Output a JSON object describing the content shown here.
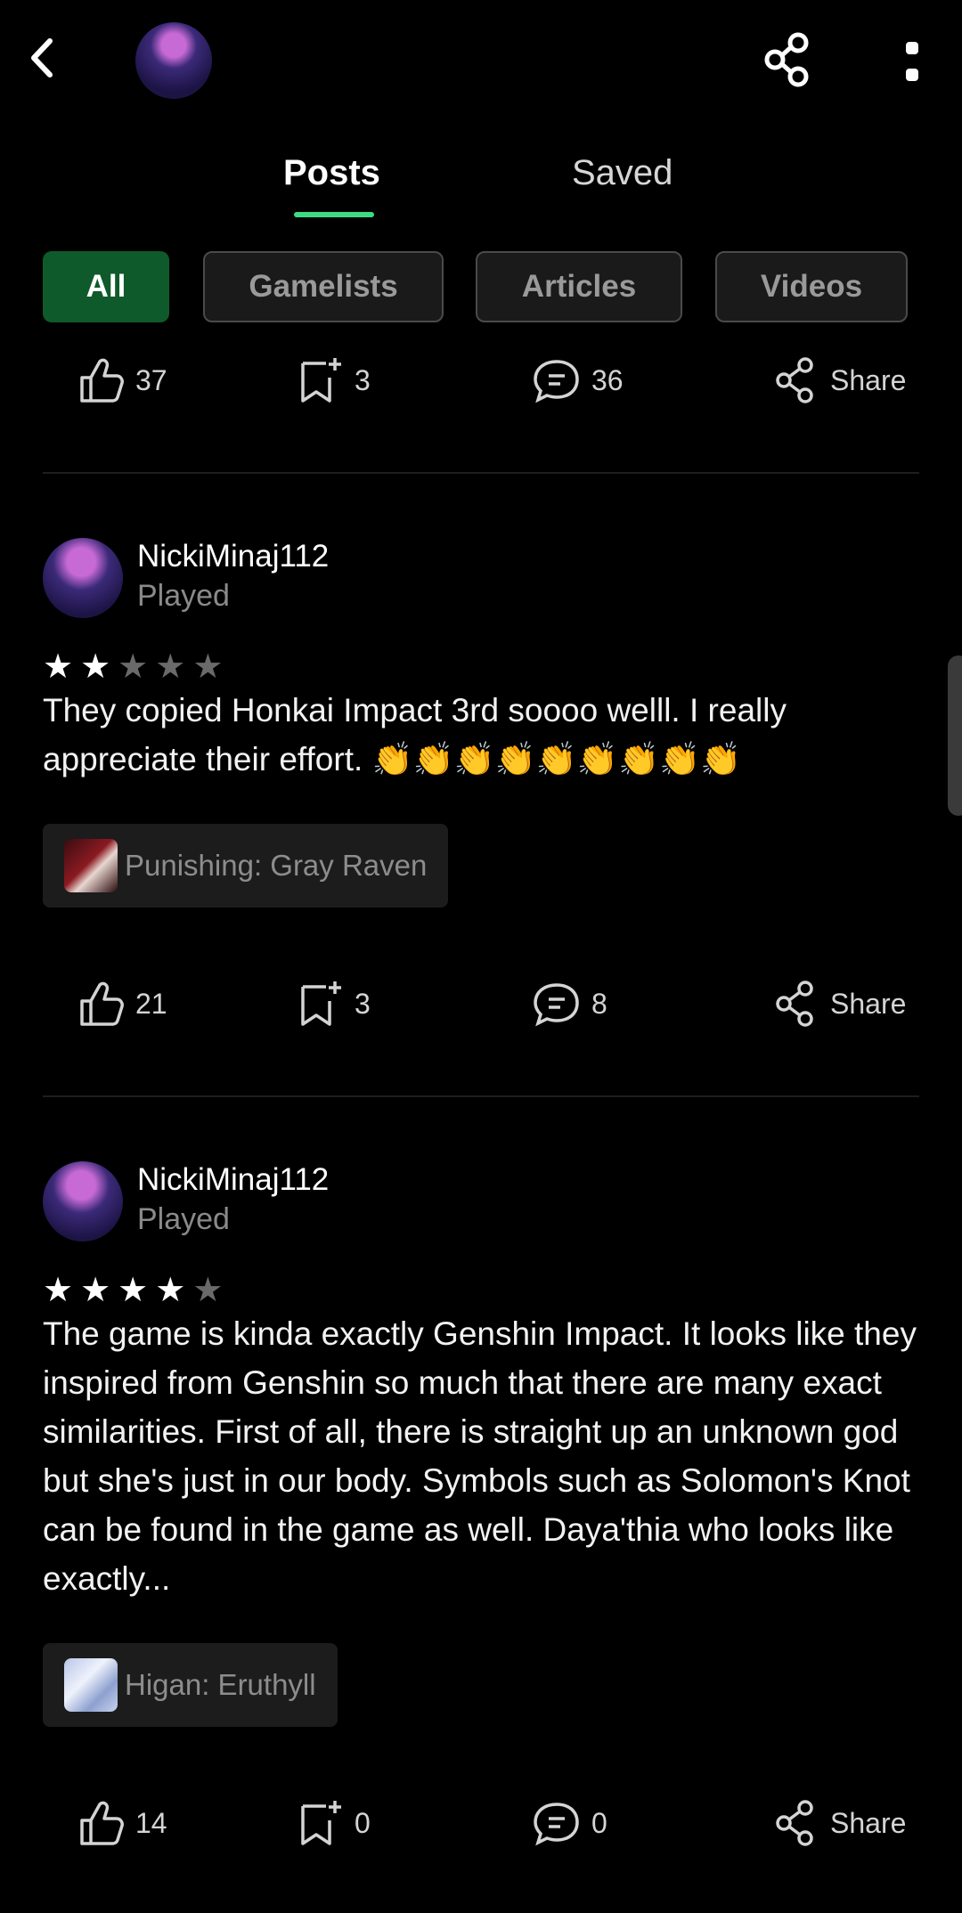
{
  "header": {
    "tabs": [
      {
        "label": "Posts"
      },
      {
        "label": "Saved"
      }
    ]
  },
  "filters": [
    "All",
    "Gamelists",
    "Articles",
    "Videos"
  ],
  "top_actions": {
    "likes": "37",
    "saves": "3",
    "comments": "36",
    "share": "Share"
  },
  "posts": [
    {
      "username": "NickiMinaj112",
      "status": "Played",
      "rating": 2,
      "text": "They copied Honkai Impact 3rd soooo welll. I really appreciate their effort. 👏👏👏👏👏👏👏👏👏",
      "game": "Punishing: Gray Raven",
      "actions": {
        "likes": "21",
        "saves": "3",
        "comments": "8",
        "share": "Share"
      }
    },
    {
      "username": "NickiMinaj112",
      "status": "Played",
      "rating": 4,
      "text": "The game is kinda exactly Genshin Impact. It looks like they inspired from Genshin so much that there are many exact similarities. First of all, there is straight up an unknown god but she's just in our body. Symbols such as Solomon's Knot can be found in the game as well. Daya'thia who looks like exactly...",
      "game": "Higan: Eruthyll",
      "actions": {
        "likes": "14",
        "saves": "0",
        "comments": "0",
        "share": "Share"
      }
    }
  ],
  "colors": {
    "accent": "#3ddc84",
    "chip_active_bg": "#0f5a2a",
    "star_filled": "#ffffff",
    "star_empty": "#6a6a6a"
  }
}
